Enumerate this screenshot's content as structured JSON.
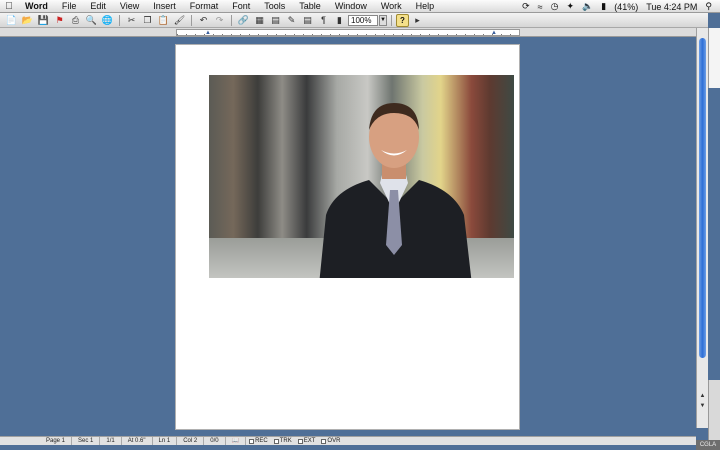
{
  "menubar": {
    "app_name": "Word",
    "items": [
      "File",
      "Edit",
      "View",
      "Insert",
      "Format",
      "Font",
      "Tools",
      "Table",
      "Window",
      "Work",
      "Help"
    ],
    "battery": "(41%)",
    "clock": "Tue 4:24 PM"
  },
  "toolbar": {
    "zoom_value": "100%",
    "pilcrow": "¶",
    "help_label": "?"
  },
  "status": {
    "page": "Page 1",
    "sec": "Sec 1",
    "pages": "1/1",
    "at": "At 0.6\"",
    "ln": "Ln 1",
    "col": "Col 2",
    "words": "0/0",
    "rec": "REC",
    "trk": "TRK",
    "ext": "EXT",
    "ovr": "OVR"
  },
  "corner_badge": "CGLA",
  "colors": {
    "desktop": "#4f6f97",
    "scroll_thumb": "#2e6ed6"
  }
}
